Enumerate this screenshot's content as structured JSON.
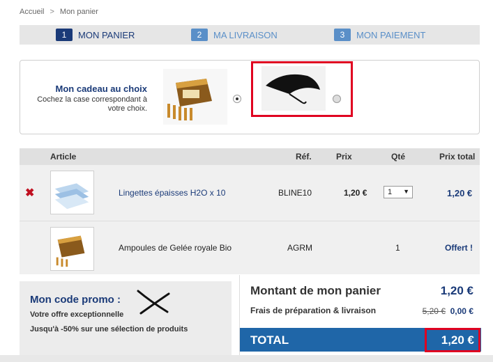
{
  "breadcrumb": {
    "home": "Accueil",
    "separator": ">",
    "current": "Mon panier"
  },
  "steps": [
    {
      "num": "1",
      "label": "MON PANIER"
    },
    {
      "num": "2",
      "label": "MA LIVRAISON"
    },
    {
      "num": "3",
      "label": "MON PAIEMENT"
    }
  ],
  "gift": {
    "title": "Mon cadeau au choix",
    "subtitle": "Cochez la case correspondant à votre choix."
  },
  "table": {
    "headers": {
      "article": "Article",
      "ref": "Réf.",
      "price": "Prix",
      "qty": "Qté",
      "total": "Prix total"
    },
    "rows": [
      {
        "name": "Lingettes épaisses H2O x 10",
        "ref": "BLINE10",
        "price": "1,20 €",
        "qty": "1",
        "total": "1,20 €"
      },
      {
        "name": "Ampoules de Gelée royale Bio",
        "ref": "AGRM",
        "price": "",
        "qty": "1",
        "total": "Offert !"
      }
    ]
  },
  "promo": {
    "title": "Mon code promo :",
    "line1": "Votre offre exceptionnelle",
    "line2": "Jusqu'à -50% sur une sélection de produits"
  },
  "summary": {
    "basket_label": "Montant de mon panier",
    "basket_value": "1,20 €",
    "fees_label": "Frais de préparation & livraison",
    "fees_old": "5,20 €",
    "fees_new": "0,00 €",
    "total_label": "TOTAL",
    "total_value": "1,20 €"
  },
  "icons": {
    "remove": "✖",
    "select_arrow": "▼"
  },
  "colors": {
    "primary": "#1a3a78",
    "secondary": "#5a8fc8",
    "total_bar": "#1f66a8",
    "highlight": "#e00020",
    "remove": "#c01020"
  }
}
